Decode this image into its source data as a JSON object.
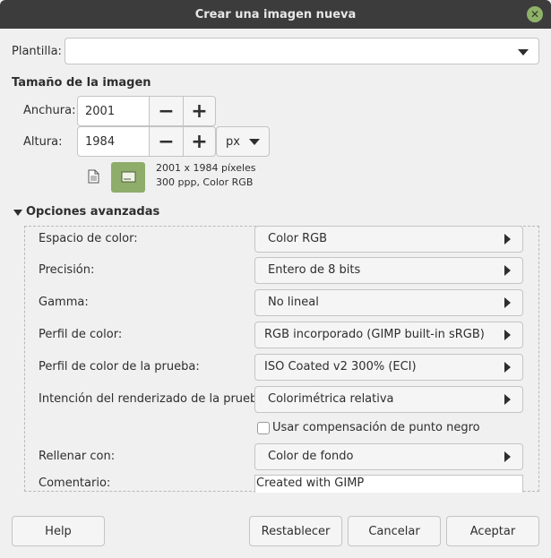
{
  "window": {
    "title": "Crear una imagen nueva"
  },
  "template": {
    "label": "Plantilla:",
    "value": ""
  },
  "image_size": {
    "heading": "Tamaño de la imagen",
    "width_label": "Anchura:",
    "width_value": "2001",
    "height_label": "Altura:",
    "height_value": "1984",
    "unit": "px",
    "info_line1": "2001 x 1984 píxeles",
    "info_line2": "300 ppp, Color RGB"
  },
  "advanced": {
    "heading": "Opciones avanzadas",
    "color_space": {
      "label": "Espacio de color:",
      "value": "Color RGB"
    },
    "precision": {
      "label": "Precisión:",
      "value": "Entero de 8 bits"
    },
    "gamma": {
      "label": "Gamma:",
      "value": "No lineal"
    },
    "color_profile": {
      "label": "Perfil de color:",
      "value": "RGB incorporado (GIMP built-in sRGB)"
    },
    "proof_profile": {
      "label": "Perfil de color de la prueba:",
      "value": "ISO Coated v2 300% (ECI)"
    },
    "proof_intent": {
      "label": "Intención del renderizado de la prueba:",
      "value": "Colorimétrica relativa"
    },
    "black_point": {
      "label": "Usar compensación de punto negro",
      "checked": false
    },
    "fill": {
      "label": "Rellenar con:",
      "value": "Color de fondo"
    },
    "comment": {
      "label": "Comentario:",
      "value": "Created with GIMP"
    }
  },
  "buttons": {
    "help": "Help",
    "reset": "Restablecer",
    "cancel": "Cancelar",
    "ok": "Aceptar"
  },
  "colors": {
    "titlebar": "#3c3c3c",
    "close": "#8fb26a",
    "preview": "#8ead6a"
  }
}
